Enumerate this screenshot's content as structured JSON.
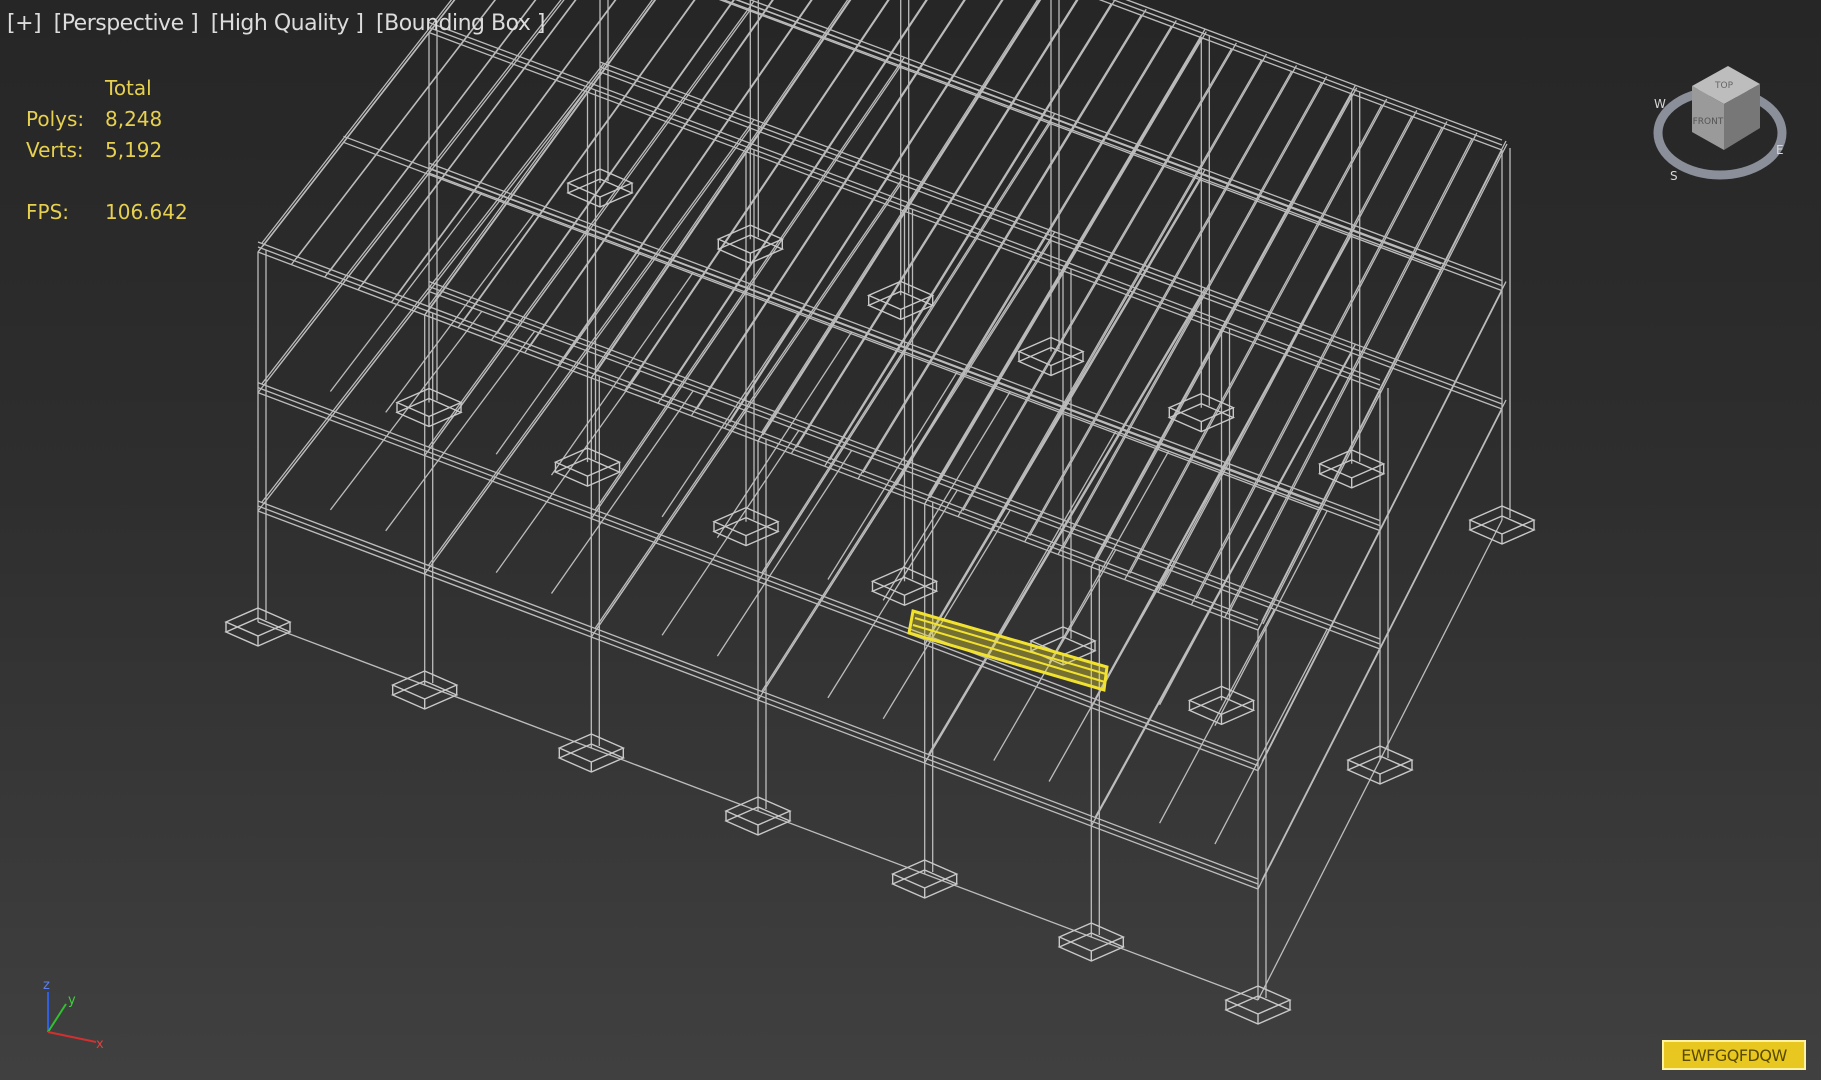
{
  "viewport": {
    "labels": [
      "[+]",
      "[Perspective ]",
      "[High Quality ]",
      "[Bounding Box ]"
    ]
  },
  "stats": {
    "header": "Total",
    "polys_label": "Polys:",
    "polys_value": "8,248",
    "verts_label": "Verts:",
    "verts_value": "5,192",
    "fps_label": "FPS:",
    "fps_value": "106.642"
  },
  "viewcube": {
    "face_top": "TOP",
    "face_front": "FRONT",
    "compass": [
      "W",
      "S",
      "E"
    ]
  },
  "axis": {
    "x": "x",
    "y": "y",
    "z": "z"
  },
  "selection": {
    "name": "EWFGQFDQW"
  },
  "colors": {
    "wire": "#c8c8c8",
    "selected": "#f2e230",
    "stats_text": "#e6d050",
    "axis_x": "#d03030",
    "axis_y": "#30c030",
    "axis_z": "#3060e0"
  }
}
